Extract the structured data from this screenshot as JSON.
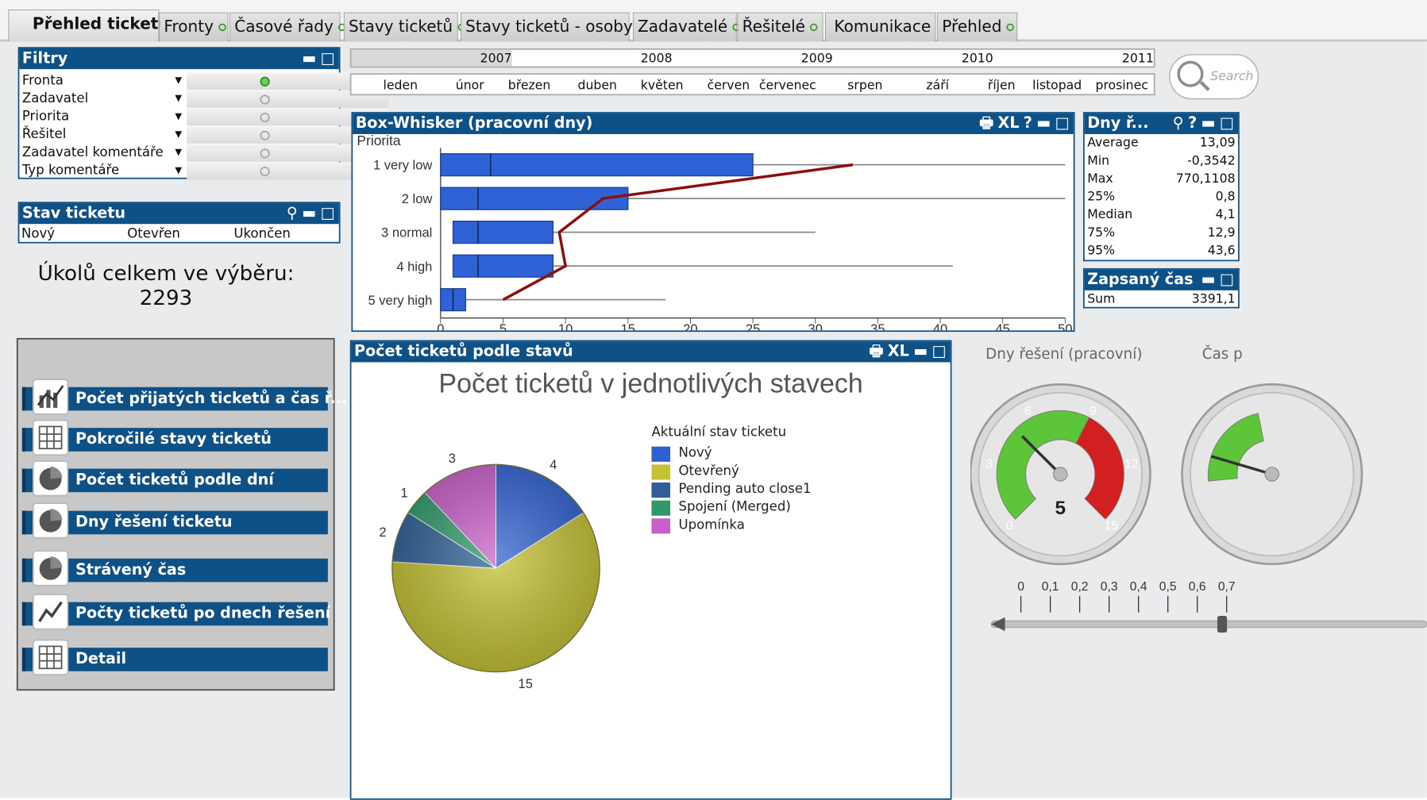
{
  "tabs": [
    {
      "label": "Přehled ticketů",
      "dot": false
    },
    {
      "label": "Fronty",
      "dot": true
    },
    {
      "label": "Časové řady",
      "dot": true
    },
    {
      "label": "Stavy ticketů",
      "dot": true
    },
    {
      "label": "Stavy ticketů - osoby",
      "dot": true
    },
    {
      "label": "Zadavatelé",
      "dot": true
    },
    {
      "label": "Řešitelé",
      "dot": true
    },
    {
      "label": "Komunikace",
      "dot": false
    },
    {
      "label": "Přehled",
      "dot": true
    }
  ],
  "filters": {
    "title": "Filtry",
    "rows": [
      {
        "label": "Fronta",
        "active": true
      },
      {
        "label": "Zadavatel",
        "active": false
      },
      {
        "label": "Priorita",
        "active": false
      },
      {
        "label": "Řešitel",
        "active": false
      },
      {
        "label": "Zadavatel komentáře",
        "active": false
      },
      {
        "label": "Typ komentáře",
        "active": false
      }
    ]
  },
  "ticket_status": {
    "title": "Stav ticketu",
    "values": [
      "Nový",
      "Otevřen",
      "Ukončen"
    ]
  },
  "total": {
    "label": "Úkolů celkem ve výběru:",
    "value": "2293"
  },
  "timeline": {
    "years": [
      "2007",
      "2008",
      "2009",
      "2010",
      "2011"
    ],
    "selected_year": "2007",
    "months": [
      "leden",
      "únor",
      "březen",
      "duben",
      "květen",
      "červen",
      "červenec",
      "srpen",
      "září",
      "říjen",
      "listopad",
      "prosinec"
    ]
  },
  "search": {
    "placeholder": "Search"
  },
  "nav_buttons": [
    {
      "label": "Počet přijatých ticketů a čas ř...",
      "icon": "line-chart-icon"
    },
    {
      "label": "Pokročilé stavy ticketů",
      "icon": "table-icon"
    },
    {
      "label": "Počet ticketů podle dní",
      "icon": "pie-chart-icon"
    },
    {
      "label": "Dny řešení ticketu",
      "icon": "pie-chart-icon"
    },
    {
      "label": "Strávený čas",
      "icon": "pie-chart-icon"
    },
    {
      "label": "Počty ticketů po dnech řešení",
      "icon": "line-chart-icon"
    },
    {
      "label": "Detail",
      "icon": "table-icon"
    }
  ],
  "stats": {
    "title": "Dny ř...",
    "rows": [
      {
        "k": "Average",
        "v": "13,09"
      },
      {
        "k": "Min",
        "v": "-0,3542"
      },
      {
        "k": "Max",
        "v": "770,1108"
      },
      {
        "k": "25%",
        "v": "0,8"
      },
      {
        "k": "Median",
        "v": "4,1"
      },
      {
        "k": "75%",
        "v": "12,9"
      },
      {
        "k": "95%",
        "v": "43,6"
      }
    ]
  },
  "logged_time": {
    "title": "Zapsaný čas",
    "row": {
      "k": "Sum",
      "v": "3391,1"
    }
  },
  "caption_icons": {
    "print": "🖶",
    "xl": "XL",
    "help": "?",
    "minimize": "▬",
    "maximize": "□",
    "search": "⚲"
  },
  "gauge_labels": {
    "g1": "Dny řešení (pracovní)",
    "g2": "Čas p"
  },
  "colors": {
    "caption": "#0d5187",
    "box": "#2f62d6",
    "median_line": "#8b0f0f",
    "green": "#5cc53a",
    "red": "#d21f1f"
  },
  "chart_data": [
    {
      "type": "box-whisker",
      "title": "Box-Whisker (pracovní dny)",
      "ylabel": "Priorita",
      "categories": [
        "1 very low",
        "2 low",
        "3 normal",
        "4 high",
        "5 very high"
      ],
      "whisker_low": [
        0,
        0,
        0,
        0,
        0
      ],
      "q1": [
        0,
        0,
        1,
        1,
        0
      ],
      "median": [
        4,
        3,
        3,
        3,
        1
      ],
      "q3": [
        25,
        15,
        9,
        9,
        2
      ],
      "whisker_high": [
        50,
        50,
        30,
        41,
        18
      ],
      "average_line": [
        33,
        13,
        9.5,
        10,
        5
      ],
      "xlim": [
        0,
        50
      ],
      "xticks": [
        0,
        5,
        10,
        15,
        20,
        25,
        30,
        35,
        40,
        45,
        50
      ]
    },
    {
      "type": "pie",
      "caption": "Počet ticketů podle stavů",
      "title": "Počet ticketů v jednotlivých stavech",
      "legend_title": "Aktuální stav ticketu",
      "categories": [
        "Nový",
        "Otevřený",
        "Pending auto close1",
        "Spojení (Merged)",
        "Upomínka"
      ],
      "values": [
        4,
        15,
        2,
        1,
        3
      ],
      "colors": [
        "#2f5fd0",
        "#c4c133",
        "#2e5f96",
        "#2e9a6a",
        "#c85ec7"
      ]
    },
    {
      "type": "gauge",
      "title": "Dny řešení (pracovní)",
      "value": 5,
      "min": 0,
      "max": 15,
      "ticks": [
        0,
        3,
        6,
        9,
        12,
        15
      ],
      "bands": [
        {
          "from": 0,
          "to": 9,
          "color": "green"
        },
        {
          "from": 9,
          "to": 15,
          "color": "red"
        }
      ]
    },
    {
      "type": "slider",
      "ticks": [
        "0",
        "0,1",
        "0,2",
        "0,3",
        "0,4",
        "0,5",
        "0,6",
        "0,7"
      ]
    }
  ]
}
